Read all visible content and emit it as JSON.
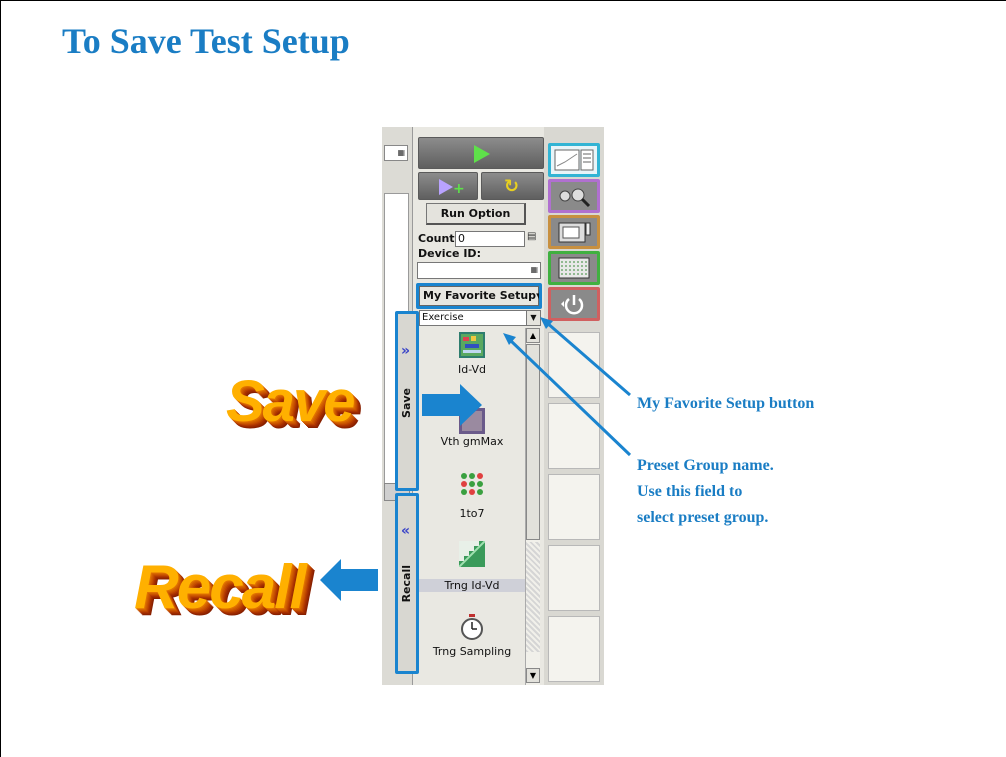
{
  "slide": {
    "title": "To Save Test Setup"
  },
  "panel": {
    "run_button": {
      "icon": "play-icon"
    },
    "append_button": {
      "icon": "play-append-icon"
    },
    "repeat_button": {
      "icon": "repeat-icon"
    },
    "run_option_label": "Run Option",
    "count_label": "Count:",
    "count_value": "0",
    "device_id_label": "Device ID:",
    "device_id_value": "",
    "favorite_setup_label": "My Favorite Setup",
    "preset_group_value": "Exercise",
    "save_tab_label": "Save",
    "recall_tab_label": "Recall",
    "setups": [
      {
        "label": "Id-Vd",
        "icon": "idvd-graph-icon"
      },
      {
        "label": "Vth gmMax",
        "icon": "vth-graph-icon"
      },
      {
        "label": "1to7",
        "icon": "dots-matrix-icon"
      },
      {
        "label": "Trng Id-Vd",
        "icon": "staircase-icon",
        "selected": true
      },
      {
        "label": "Trng Sampling",
        "icon": "stopwatch-icon"
      }
    ],
    "side_buttons": [
      {
        "name": "data-display",
        "color": "#32b4d4"
      },
      {
        "name": "tools",
        "color": "#b070d0"
      },
      {
        "name": "instrument-setup",
        "color": "#c89040"
      },
      {
        "name": "calculator",
        "color": "#40b040"
      },
      {
        "name": "power",
        "color": "#d06060"
      }
    ]
  },
  "annotations": {
    "save_word": "Save",
    "recall_word": "Recall",
    "favorite_button_note": "My Favorite Setup button",
    "preset_note_line1": "Preset Group name.",
    "preset_note_line2": "Use this field to",
    "preset_note_line3": "select preset group."
  },
  "colors": {
    "title": "#1a7dc4",
    "highlight": "#1a84cf",
    "arrow": "#1a84cf",
    "wordart": "#ffb000"
  }
}
